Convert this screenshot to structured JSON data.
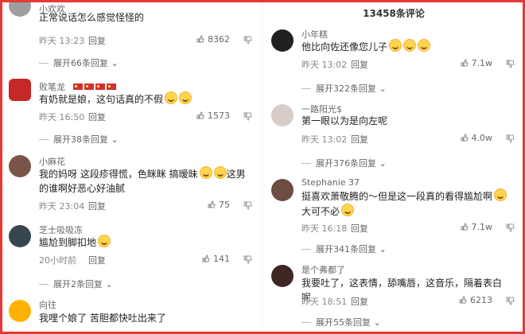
{
  "header": {
    "comment_count": "13458条评论"
  },
  "left": [
    {
      "username": "小欢欢",
      "text": "正常说话怎么感觉怪怪的",
      "time": "昨天 13:23",
      "reply": "回复",
      "likes": "8362",
      "expand": "展开66条回复"
    },
    {
      "username": "败笔龙",
      "text": "有奶就是娘，这句话真的不假",
      "emojis": 2,
      "flags": 4,
      "time": "昨天 16:50",
      "reply": "回复",
      "likes": "1573",
      "expand": "展开38条回复"
    },
    {
      "username": "小麻花",
      "text_line1": "我的妈呀 这段疹得慌，色眯眯 搞暧昧",
      "text_line2": "的谁啊好恶心好油腻",
      "trail_text": "这男",
      "emojis": 2,
      "time": "昨天 23:04",
      "reply": "回复",
      "likes": "75",
      "expand": ""
    },
    {
      "username": "芝士吸吸冻",
      "text": "尴尬到脚扣地",
      "emojis": 1,
      "time": "20小时前",
      "reply": "回复",
      "likes": "141",
      "expand": "展开2条回复"
    },
    {
      "username": "向往",
      "text": "我哩个娘了 苦胆都快吐出来了",
      "time": "",
      "reply": "",
      "likes": "",
      "expand": ""
    }
  ],
  "right": [
    {
      "username": "小年糕",
      "text": "他比向佐还像您儿子",
      "emojis": 3,
      "time": "昨天 13:02",
      "reply": "回复",
      "likes": "7.1w",
      "expand": "展开322条回复"
    },
    {
      "username": "一路阳光$",
      "text": "第一眼以为是向左呢",
      "time": "昨天 13:02",
      "reply": "回复",
      "likes": "4.0w",
      "expand": "展开376条回复"
    },
    {
      "username": "Stephanie 37",
      "text_line1": "挺喜欢萧敬腾的～但是这一段真的看得尴尬啊",
      "text_line2": "大可不必",
      "emojis": 2,
      "time": "昨天 16:18",
      "reply": "回复",
      "likes": "7.1w",
      "expand": "展开341条回复"
    },
    {
      "username": "是个弗都了",
      "text": "我要吐了，这表情，舔嘴唇，这音乐，隔着表白呢",
      "time": "昨天 18:51",
      "reply": "回复",
      "likes": "6213",
      "expand": "展开55条回复"
    }
  ],
  "colors": {
    "border": "#e53935",
    "meta": "#888888",
    "text": "#222222"
  },
  "icons": {
    "like": "thumb-up-icon",
    "dislike": "thumb-down-icon"
  }
}
